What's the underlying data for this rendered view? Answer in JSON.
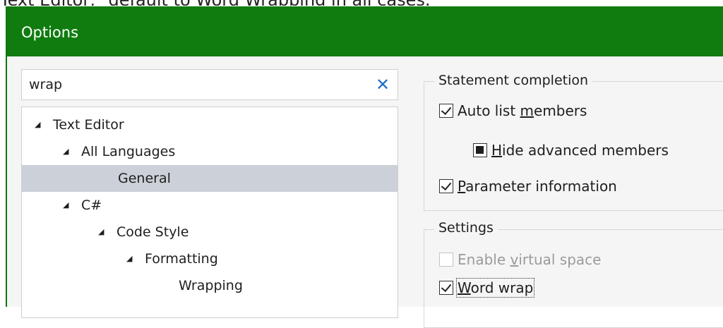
{
  "caption": "Text Editor, \"default to Word Wrapping in all cases.",
  "window": {
    "title": "Options"
  },
  "search": {
    "value": "wrap",
    "clear_icon": "close-icon",
    "clear_glyph": "✕"
  },
  "tree": {
    "caret_icon": "caret-down-icon",
    "caret_glyph": "◢",
    "items": [
      {
        "label": "Text Editor",
        "expanded": true,
        "selected": false
      },
      {
        "label": "All Languages",
        "expanded": true,
        "selected": false
      },
      {
        "label": "General",
        "expanded": false,
        "selected": true
      },
      {
        "label": "C#",
        "expanded": true,
        "selected": false
      },
      {
        "label": "Code Style",
        "expanded": true,
        "selected": false
      },
      {
        "label": "Formatting",
        "expanded": true,
        "selected": false
      },
      {
        "label": "Wrapping",
        "expanded": false,
        "selected": false
      }
    ]
  },
  "statement_completion": {
    "title": "Statement completion",
    "auto_list_members": {
      "pre": "Auto list ",
      "u": "m",
      "post": "embers",
      "state": "checked"
    },
    "hide_advanced_members": {
      "pre": "",
      "u": "H",
      "post": "ide advanced members",
      "state": "indeterminate"
    },
    "parameter_information": {
      "pre": "",
      "u": "P",
      "post": "arameter information",
      "state": "checked"
    }
  },
  "settings": {
    "title": "Settings",
    "enable_virtual_space": {
      "pre": "Enable ",
      "u": "v",
      "post": "irtual space",
      "state": "unchecked",
      "enabled": false
    },
    "word_wrap": {
      "pre": "",
      "u": "W",
      "post": "ord wrap",
      "state": "checked",
      "focused": true
    }
  },
  "colors": {
    "titlebar": "#107c10",
    "selection": "#ccd0d8",
    "clear_icon": "#1f6fc5"
  }
}
